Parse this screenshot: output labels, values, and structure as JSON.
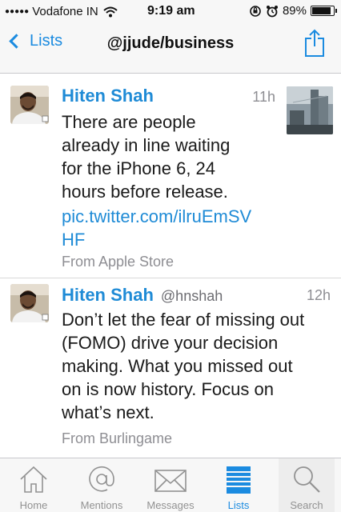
{
  "status_bar": {
    "carrier": "Vodafone IN",
    "time": "9:19 am",
    "battery": "89%",
    "battery_level": 0.89
  },
  "nav": {
    "back_label": "Lists",
    "title": "@jjude/business"
  },
  "tweets": [
    {
      "name": "Hiten Shah",
      "handle": "",
      "time": "11h",
      "text_lines": [
        "There are people",
        "already in line waiting",
        "for the iPhone 6, 24",
        "hours before release."
      ],
      "link_lines": [
        "pic.twitter.com/ilruEmSV",
        "HF"
      ],
      "source": "From Apple Store"
    },
    {
      "name": "Hiten Shah",
      "handle": "@hnshah",
      "time": "12h",
      "text_lines": [
        "Don’t let the fear of missing out",
        "(FOMO) drive your decision",
        "making. What you missed out",
        "on is now history. Focus on",
        "what’s next."
      ],
      "source": "From Burlingame"
    }
  ],
  "tab_bar": {
    "tabs": [
      {
        "label": "Home",
        "icon": "home-icon"
      },
      {
        "label": "Mentions",
        "icon": "at-icon"
      },
      {
        "label": "Messages",
        "icon": "envelope-icon"
      },
      {
        "label": "Lists",
        "icon": "list-icon"
      },
      {
        "label": "Search",
        "icon": "search-icon"
      }
    ],
    "active": "Lists"
  },
  "colors": {
    "accent": "#1b8be0",
    "name": "#1f8bd6",
    "muted": "#8e8e93"
  }
}
